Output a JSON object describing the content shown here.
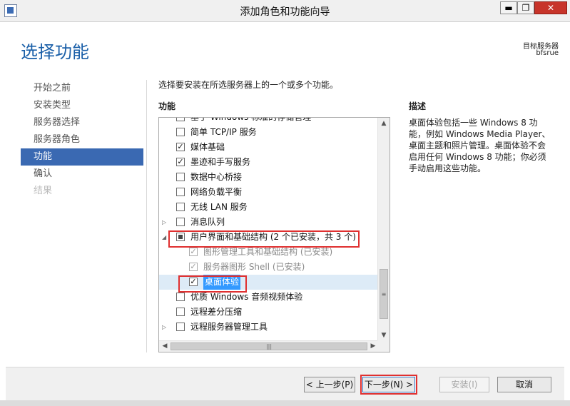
{
  "window": {
    "title": "添加角色和功能向导",
    "minimize_label": "▬",
    "restore_label": "❐",
    "close_label": "✕",
    "icon": "server-manager-icon"
  },
  "header": {
    "page_title": "选择功能",
    "destination_label": "目标服务器",
    "destination_server": "bfsrue"
  },
  "nav": {
    "items": [
      {
        "label": "开始之前",
        "state": "normal"
      },
      {
        "label": "安装类型",
        "state": "normal"
      },
      {
        "label": "服务器选择",
        "state": "normal"
      },
      {
        "label": "服务器角色",
        "state": "normal"
      },
      {
        "label": "功能",
        "state": "active"
      },
      {
        "label": "确认",
        "state": "normal"
      },
      {
        "label": "结果",
        "state": "disabled"
      }
    ]
  },
  "main": {
    "instruction": "选择要安装在所选服务器上的一个或多个功能。",
    "features_header": "功能",
    "description_header": "描述",
    "description": "桌面体验包括一些 Windows 8 功能，例如 Windows Media Player、桌面主题和照片管理。桌面体验不会启用任何 Windows 8 功能；你必须手动启用这些功能。",
    "features": [
      {
        "label": "基于 Windows 标准的存储管理",
        "checked": false,
        "expander": ""
      },
      {
        "label": "简单 TCP/IP 服务",
        "checked": false,
        "expander": ""
      },
      {
        "label": "媒体基础",
        "checked": true,
        "expander": ""
      },
      {
        "label": "墨迹和手写服务",
        "checked": true,
        "expander": ""
      },
      {
        "label": "数据中心桥接",
        "checked": false,
        "expander": ""
      },
      {
        "label": "网络负载平衡",
        "checked": false,
        "expander": ""
      },
      {
        "label": "无线 LAN 服务",
        "checked": false,
        "expander": ""
      },
      {
        "label": "消息队列",
        "checked": false,
        "expander": "▷"
      },
      {
        "label": "用户界面和基础结构 (2 个已安装，共 3 个)",
        "checked": "partial",
        "expander": "◢"
      },
      {
        "label": "图形管理工具和基础结构 (已安装)",
        "checked": true,
        "expander": "",
        "indent": 1,
        "installed": true
      },
      {
        "label": "服务器图形 Shell (已安装)",
        "checked": true,
        "expander": "",
        "indent": 1,
        "installed": true
      },
      {
        "label": "桌面体验",
        "checked": true,
        "expander": "",
        "indent": 1,
        "selected": true
      },
      {
        "label": "优质 Windows 音频视频体验",
        "checked": false,
        "expander": ""
      },
      {
        "label": "远程差分压缩",
        "checked": false,
        "expander": ""
      },
      {
        "label": "远程服务器管理工具",
        "checked": false,
        "expander": "▷"
      }
    ]
  },
  "footer": {
    "prev_label": "< 上一步(P)",
    "next_label": "下一步(N) >",
    "install_label": "安装(I)",
    "cancel_label": "取消"
  },
  "colors": {
    "accent": "#3a69b2",
    "title": "#1a5fa8",
    "highlight_box": "#e03030",
    "selected_row": "#ddebf7"
  }
}
